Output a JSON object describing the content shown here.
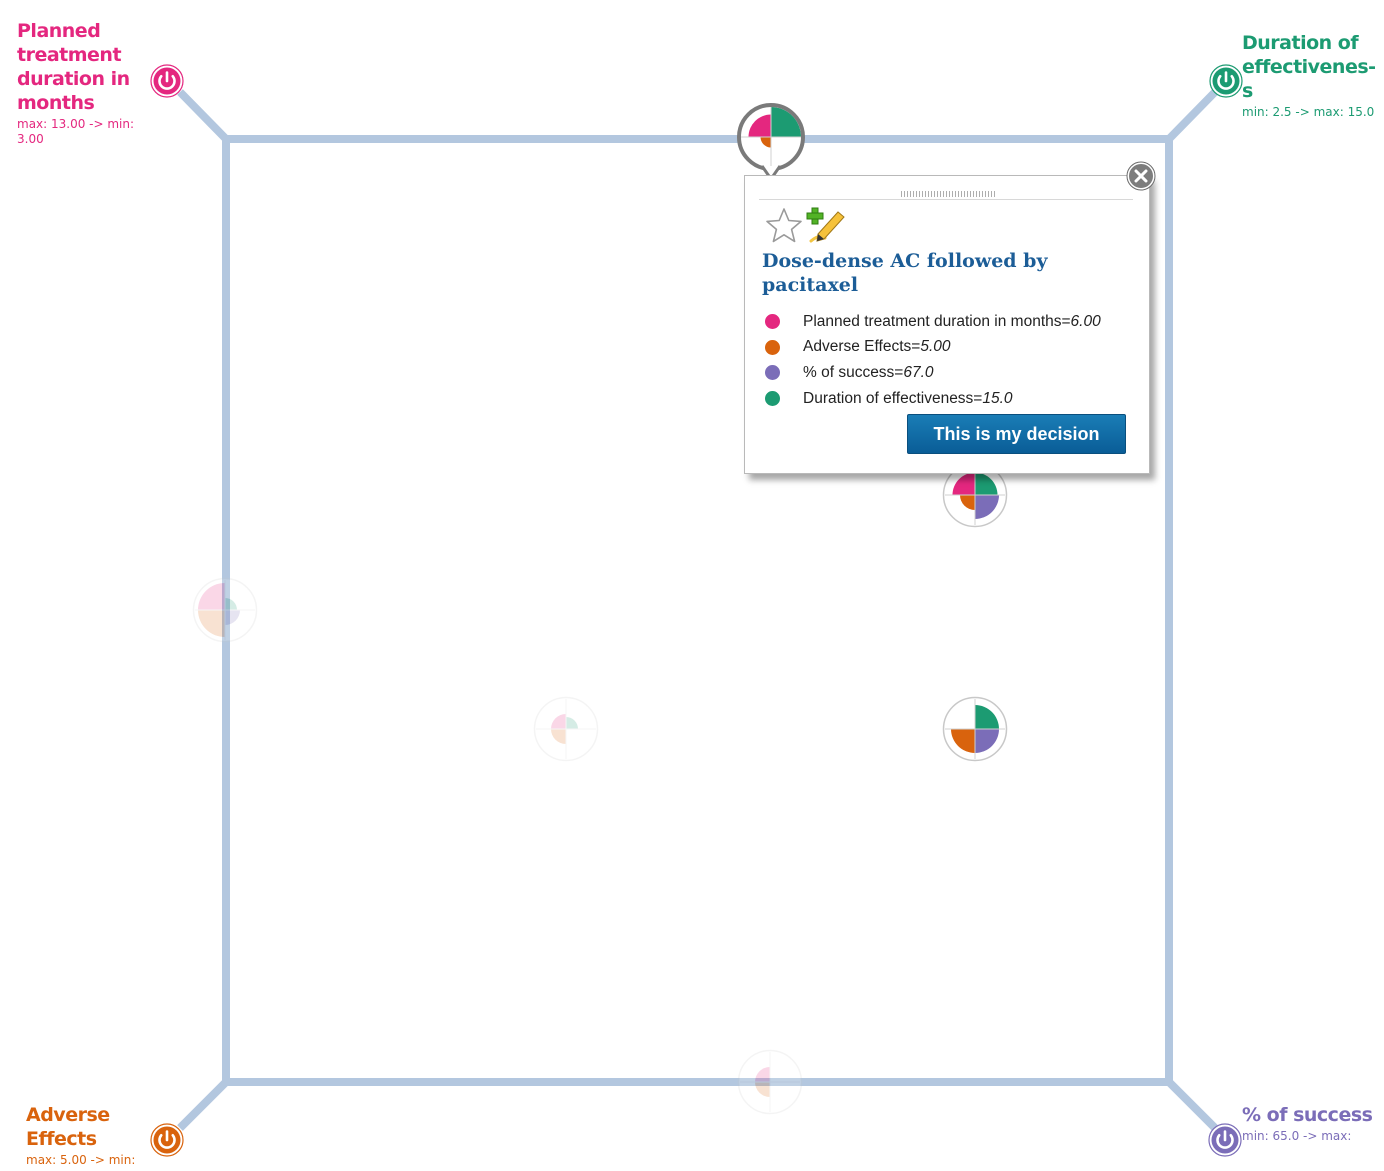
{
  "colors": {
    "frame": "#b3c7df",
    "treatment_duration": "#e4277f",
    "adverse_effects": "#d9630d",
    "success": "#7b6db8",
    "effectiveness": "#1c9b72",
    "title_blue": "#1c5d97"
  },
  "corners": {
    "top_left": {
      "title": "Planned treatment duration in months",
      "range": "max: 13.00 -> min: 3.00",
      "toggle_icon": "power-icon"
    },
    "top_right": {
      "title": "Duration of effectivenes-s",
      "range": "min: 2.5 -> max: 15.0",
      "toggle_icon": "power-icon"
    },
    "bottom_left": {
      "title": "Adverse Effects",
      "range": "max: 5.00 -> min:",
      "toggle_icon": "power-icon"
    },
    "bottom_right": {
      "title": "% of success",
      "range": "min: 65.0 -> max:",
      "toggle_icon": "power-icon"
    }
  },
  "popup": {
    "title": "Dose-dense AC followed by pacitaxel",
    "favorite_icon": "star-icon",
    "note_icon": "add-note-pencil-icon",
    "close_icon": "close-icon",
    "attributes": [
      {
        "label": "Planned treatment duration in months=",
        "value": "6.00",
        "color": "#e4277f"
      },
      {
        "label": "Adverse Effects=",
        "value": "5.00",
        "color": "#d9630d"
      },
      {
        "label": "% of success=",
        "value": "67.0",
        "color": "#7b6db8"
      },
      {
        "label": "Duration of effectiveness=",
        "value": "15.0",
        "color": "#1c9b72"
      }
    ],
    "decision_label": "This is my decision"
  },
  "markers": [
    {
      "name": "selected-option",
      "state": "selected",
      "quadrants": {
        "tl": 0.75,
        "tr": 1.0,
        "br": 0,
        "bl": 0.35
      }
    },
    {
      "name": "option-upper-right",
      "state": "normal",
      "quadrants": {
        "tl": 0.75,
        "tr": 0.75,
        "br": 0.8,
        "bl": 0.5
      }
    },
    {
      "name": "option-lower-right",
      "state": "normal",
      "quadrants": {
        "tl": 0,
        "tr": 0.8,
        "br": 0.8,
        "bl": 0.8
      }
    },
    {
      "name": "option-left",
      "state": "faded",
      "quadrants": {
        "tl": 0.9,
        "tr": 0.4,
        "br": 0.5,
        "bl": 0.9
      }
    },
    {
      "name": "option-center",
      "state": "faded",
      "quadrants": {
        "tl": 0.5,
        "tr": 0.4,
        "br": 0,
        "bl": 0.5
      }
    },
    {
      "name": "option-bottom",
      "state": "faded",
      "quadrants": {
        "tl": 0.5,
        "tr": 0,
        "br": 0,
        "bl": 0.5
      }
    }
  ]
}
